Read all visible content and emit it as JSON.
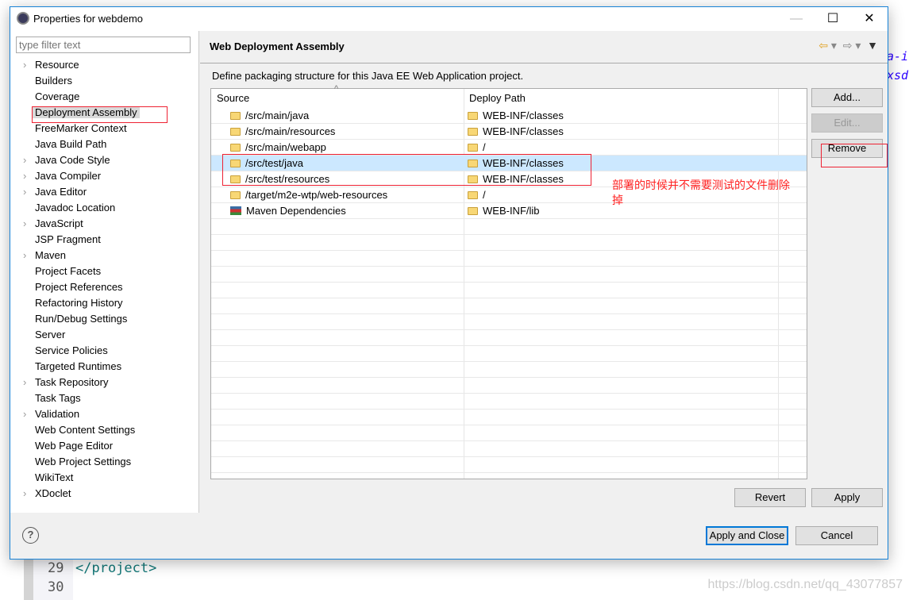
{
  "window": {
    "title": "Properties for webdemo",
    "minimize": "—",
    "maximize": "☐",
    "close": "✕"
  },
  "filter": {
    "placeholder": "type filter text"
  },
  "nav": [
    {
      "label": "Resource",
      "expandable": true
    },
    {
      "label": "Builders"
    },
    {
      "label": "Coverage"
    },
    {
      "label": "Deployment Assembly",
      "selected": true
    },
    {
      "label": "FreeMarker Context"
    },
    {
      "label": "Java Build Path"
    },
    {
      "label": "Java Code Style",
      "expandable": true
    },
    {
      "label": "Java Compiler",
      "expandable": true
    },
    {
      "label": "Java Editor",
      "expandable": true
    },
    {
      "label": "Javadoc Location"
    },
    {
      "label": "JavaScript",
      "expandable": true
    },
    {
      "label": "JSP Fragment"
    },
    {
      "label": "Maven",
      "expandable": true
    },
    {
      "label": "Project Facets"
    },
    {
      "label": "Project References"
    },
    {
      "label": "Refactoring History"
    },
    {
      "label": "Run/Debug Settings"
    },
    {
      "label": "Server"
    },
    {
      "label": "Service Policies"
    },
    {
      "label": "Targeted Runtimes"
    },
    {
      "label": "Task Repository",
      "expandable": true
    },
    {
      "label": "Task Tags"
    },
    {
      "label": "Validation",
      "expandable": true
    },
    {
      "label": "Web Content Settings"
    },
    {
      "label": "Web Page Editor"
    },
    {
      "label": "Web Project Settings"
    },
    {
      "label": "WikiText"
    },
    {
      "label": "XDoclet",
      "expandable": true
    }
  ],
  "page": {
    "title": "Web Deployment Assembly",
    "description": "Define packaging structure for this Java EE Web Application project.",
    "columns": [
      "Source",
      "Deploy Path"
    ],
    "rows": [
      {
        "source": "/src/main/java",
        "deploy": "WEB-INF/classes",
        "icon": "folder-icon"
      },
      {
        "source": "/src/main/resources",
        "deploy": "WEB-INF/classes",
        "icon": "folder-icon"
      },
      {
        "source": "/src/main/webapp",
        "deploy": "/",
        "icon": "folder-icon"
      },
      {
        "source": "/src/test/java",
        "deploy": "WEB-INF/classes",
        "icon": "folder-icon",
        "selected": true
      },
      {
        "source": "/src/test/resources",
        "deploy": "WEB-INF/classes",
        "icon": "folder-icon"
      },
      {
        "source": "/target/m2e-wtp/web-resources",
        "deploy": "/",
        "icon": "folder-icon"
      },
      {
        "source": "Maven Dependencies",
        "deploy": "WEB-INF/lib",
        "icon": "library-icon"
      }
    ],
    "buttons": {
      "add": "Add...",
      "edit": "Edit...",
      "remove": "Remove",
      "revert": "Revert",
      "apply": "Apply"
    },
    "annotation": "部署的时候并不需要测试的文件删除掉"
  },
  "footer": {
    "apply_close": "Apply and Close",
    "cancel": "Cancel",
    "help": "?"
  },
  "background": {
    "line29": "29",
    "line30": "30",
    "code29": "</project>",
    "code_right1": "a-i",
    "code_right2": "xsd",
    "watermark": "https://blog.csdn.net/qq_43077857"
  },
  "colors": {
    "accent": "#0078d7",
    "selection": "#cce8ff",
    "annotation": "#ff2222"
  }
}
